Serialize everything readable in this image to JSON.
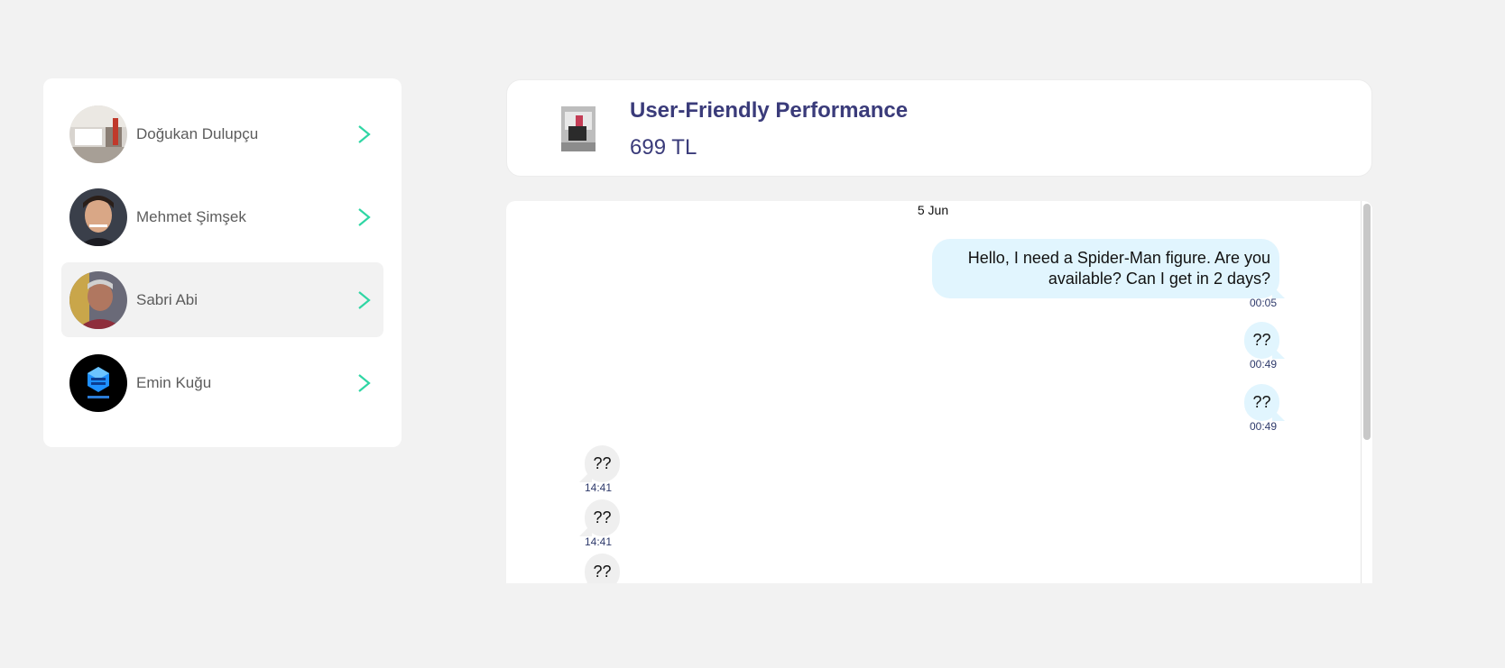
{
  "contacts": [
    {
      "name": "Doğukan Dulupçu",
      "active": false
    },
    {
      "name": "Mehmet Şimşek",
      "active": false
    },
    {
      "name": "Sabri Abi",
      "active": true
    },
    {
      "name": "Emin Kuğu",
      "active": false
    }
  ],
  "product": {
    "title": "User-Friendly Performance",
    "price": "699 TL"
  },
  "chat": {
    "date": "5 Jun",
    "messages": [
      {
        "direction": "out",
        "text": "Hello, I need a Spider-Man figure. Are you available? Can I get in 2 days?",
        "time": "00:05"
      },
      {
        "direction": "out",
        "text": "??",
        "time": "00:49"
      },
      {
        "direction": "out",
        "text": "??",
        "time": "00:49"
      },
      {
        "direction": "in",
        "text": "??",
        "time": "14:41"
      },
      {
        "direction": "in",
        "text": "??",
        "time": "14:41"
      },
      {
        "direction": "in",
        "text": "??",
        "time": ""
      }
    ]
  },
  "colors": {
    "accent": "#2fd6a4",
    "title": "#3a3b7a",
    "bubble_out": "#e1f5fe",
    "bubble_in": "#efefef"
  }
}
